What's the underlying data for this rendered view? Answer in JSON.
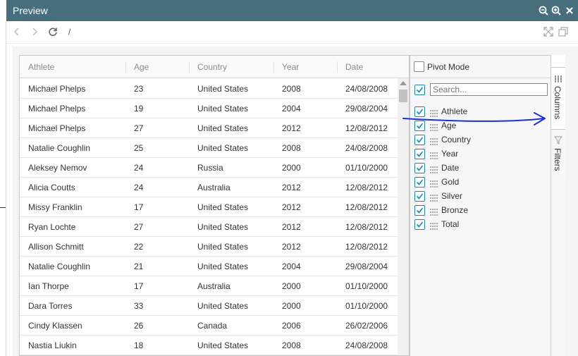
{
  "window": {
    "title": "Preview"
  },
  "toolbar": {
    "path": "/"
  },
  "grid": {
    "columns": [
      "Athlete",
      "Age",
      "Country",
      "Year",
      "Date"
    ],
    "rows": [
      [
        "Michael Phelps",
        "23",
        "United States",
        "2008",
        "24/08/2008"
      ],
      [
        "Michael Phelps",
        "19",
        "United States",
        "2004",
        "29/08/2004"
      ],
      [
        "Michael Phelps",
        "27",
        "United States",
        "2012",
        "12/08/2012"
      ],
      [
        "Natalie Coughlin",
        "25",
        "United States",
        "2008",
        "24/08/2008"
      ],
      [
        "Aleksey Nemov",
        "24",
        "Russia",
        "2000",
        "01/10/2000"
      ],
      [
        "Alicia Coutts",
        "24",
        "Australia",
        "2012",
        "12/08/2012"
      ],
      [
        "Missy Franklin",
        "17",
        "United States",
        "2012",
        "12/08/2012"
      ],
      [
        "Ryan Lochte",
        "27",
        "United States",
        "2012",
        "12/08/2012"
      ],
      [
        "Allison Schmitt",
        "22",
        "United States",
        "2012",
        "12/08/2012"
      ],
      [
        "Natalie Coughlin",
        "21",
        "United States",
        "2004",
        "29/08/2004"
      ],
      [
        "Ian Thorpe",
        "17",
        "Australia",
        "2000",
        "01/10/2000"
      ],
      [
        "Dara Torres",
        "33",
        "United States",
        "2000",
        "01/10/2000"
      ],
      [
        "Cindy Klassen",
        "26",
        "Canada",
        "2006",
        "26/02/2006"
      ],
      [
        "Nastia Liukin",
        "18",
        "United States",
        "2008",
        "24/08/2008"
      ]
    ]
  },
  "tool_panel": {
    "pivot_label": "Pivot Mode",
    "pivot_checked": false,
    "search_placeholder": "Search...",
    "columns": [
      {
        "label": "Athlete",
        "checked": true
      },
      {
        "label": "Age",
        "checked": true
      },
      {
        "label": "Country",
        "checked": true
      },
      {
        "label": "Year",
        "checked": true
      },
      {
        "label": "Date",
        "checked": true
      },
      {
        "label": "Gold",
        "checked": true
      },
      {
        "label": "Silver",
        "checked": true
      },
      {
        "label": "Bronze",
        "checked": true
      },
      {
        "label": "Total",
        "checked": true
      }
    ]
  },
  "side_bar": {
    "tabs": [
      "Columns",
      "Filters"
    ]
  },
  "colors": {
    "titlebar": "#476e7d",
    "accent": "#1b85b8",
    "annotation": "#1a2fd6"
  }
}
